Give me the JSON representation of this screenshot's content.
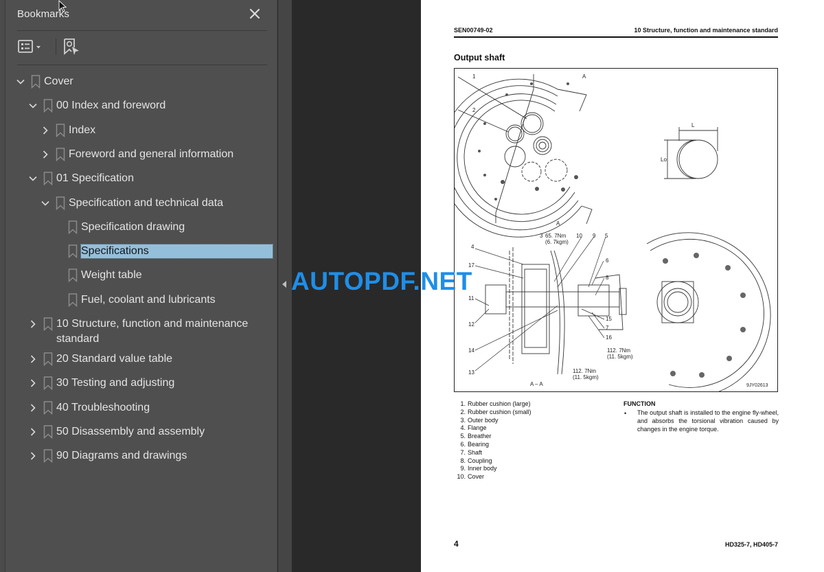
{
  "bookmarks_panel": {
    "title": "Bookmarks",
    "close_label": "Close",
    "toolbar": {
      "options_icon": "list-options-icon",
      "find_current_icon": "find-current-bookmark-icon"
    },
    "items": [
      {
        "label": "Cover",
        "level": 0,
        "state": "expanded"
      },
      {
        "label": "00 Index and foreword",
        "level": 1,
        "state": "expanded"
      },
      {
        "label": "Index",
        "level": 2,
        "state": "collapsed"
      },
      {
        "label": "Foreword and general information",
        "level": 2,
        "state": "collapsed"
      },
      {
        "label": "01 Specification",
        "level": 1,
        "state": "expanded"
      },
      {
        "label": "Specification and technical data",
        "level": 2,
        "state": "expanded"
      },
      {
        "label": "Specification drawing",
        "level": 3,
        "state": "leaf"
      },
      {
        "label": "Specifications",
        "level": 3,
        "state": "leaf",
        "selected": true
      },
      {
        "label": "Weight table",
        "level": 3,
        "state": "leaf"
      },
      {
        "label": "Fuel, coolant and lubricants",
        "level": 3,
        "state": "leaf"
      },
      {
        "label": "10 Structure, function and maintenance standard",
        "level": 1,
        "state": "collapsed"
      },
      {
        "label": "20 Standard value table",
        "level": 1,
        "state": "collapsed"
      },
      {
        "label": "30 Testing and adjusting",
        "level": 1,
        "state": "collapsed"
      },
      {
        "label": "40 Troubleshooting",
        "level": 1,
        "state": "collapsed"
      },
      {
        "label": "50 Disassembly and assembly",
        "level": 1,
        "state": "collapsed"
      },
      {
        "label": "90 Diagrams and drawings",
        "level": 1,
        "state": "collapsed"
      }
    ]
  },
  "watermark": "AUTOPDF.NET",
  "page": {
    "doc_code": "SEN00749-02",
    "section": "10 Structure, function and maintenance standard",
    "title": "Output shaft",
    "figure": {
      "id": "9JY02613",
      "section_label": "A – A",
      "cut_marker": "A",
      "dim_L": "L",
      "dim_Lo": "Lo",
      "torque_1": "65. 7Nm",
      "torque_1_alt": "(6. 7kgm)",
      "torque_2": "112. 7Nm",
      "torque_2_alt": "(11. 5kgm)",
      "callouts": [
        "1",
        "2",
        "3",
        "4",
        "5",
        "6",
        "7",
        "8",
        "9",
        "10",
        "11",
        "12",
        "13",
        "14",
        "15",
        "16",
        "17"
      ]
    },
    "parts": [
      {
        "num": "1.",
        "name": "Rubber cushion (large)"
      },
      {
        "num": "2.",
        "name": "Rubber cushion (small)"
      },
      {
        "num": "3.",
        "name": "Outer body"
      },
      {
        "num": "4.",
        "name": "Flange"
      },
      {
        "num": "5.",
        "name": "Breather"
      },
      {
        "num": "6.",
        "name": "Bearing"
      },
      {
        "num": "7.",
        "name": "Shaft"
      },
      {
        "num": "8.",
        "name": "Coupling"
      },
      {
        "num": "9.",
        "name": "Inner body"
      },
      {
        "num": "10.",
        "name": "Cover"
      }
    ],
    "function": {
      "title": "FUNCTION",
      "bullet": "•",
      "text": "The output shaft is installed to the engine fly-wheel, and absorbs the torsional vibration caused by changes in the engine torque."
    },
    "page_number": "4",
    "model": "HD325-7, HD405-7"
  },
  "colors": {
    "panel_bg": "#4f4f4f",
    "doc_bg": "#292929",
    "selection": "#94bfdb",
    "watermark": "#1f8ee8"
  }
}
